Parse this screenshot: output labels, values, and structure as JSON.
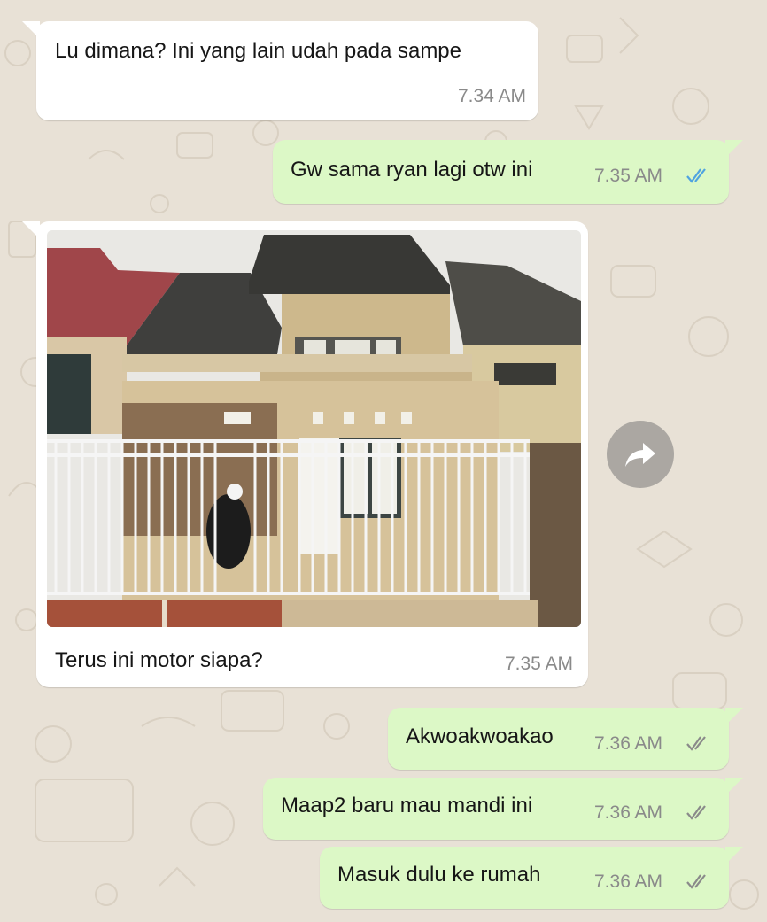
{
  "colors": {
    "wallpaper": "#e8e1d6",
    "incoming_bubble": "#ffffff",
    "outgoing_bubble": "#dcf8c6",
    "read_ticks": "#4fa3e0",
    "delivered_ticks": "#8a8a8a"
  },
  "messages": [
    {
      "direction": "incoming",
      "text": "Lu dimana? Ini yang lain udah pada sampe",
      "time": "7.34 AM"
    },
    {
      "direction": "outgoing",
      "text": "Gw sama ryan lagi otw ini",
      "time": "7.35 AM",
      "status": "read"
    },
    {
      "direction": "incoming",
      "type": "image",
      "image_icon": "house-photo",
      "caption": "Terus ini motor siapa?",
      "time": "7.35 AM"
    },
    {
      "direction": "outgoing",
      "text": "Akwoakwoakao",
      "time": "7.36 AM",
      "status": "delivered"
    },
    {
      "direction": "outgoing",
      "text": "Maap2 baru mau mandi ini",
      "time": "7.36 AM",
      "status": "delivered"
    },
    {
      "direction": "outgoing",
      "text": "Masuk dulu ke rumah",
      "time": "7.36 AM",
      "status": "delivered"
    }
  ],
  "forward_icon": "forward-arrow-icon"
}
